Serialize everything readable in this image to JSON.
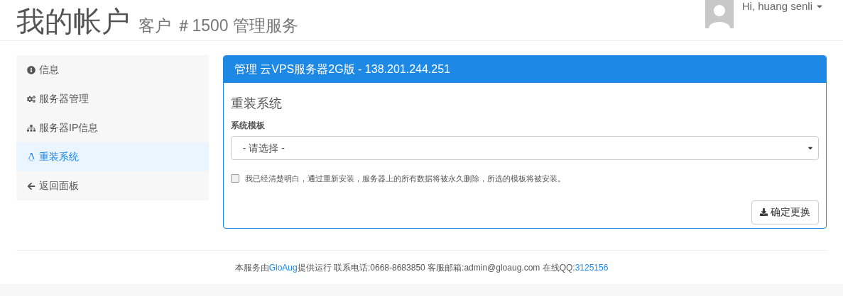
{
  "header": {
    "title": "我的帐户",
    "subtitle": "客户 ＃1500 管理服务"
  },
  "user": {
    "greeting": "Hi, huang senli"
  },
  "sidebar": {
    "items": [
      {
        "label": "信息",
        "selected": false
      },
      {
        "label": "服务器管理",
        "selected": false
      },
      {
        "label": "服务器IP信息",
        "selected": false
      },
      {
        "label": "重装系统",
        "selected": true
      },
      {
        "label": "返回面板",
        "selected": false
      }
    ]
  },
  "panel": {
    "title": "管理 云VPS服务器2G版 - 138.201.244.251",
    "heading": "重装系统",
    "field_label": "系统模板",
    "select_value": "- 请选择 -",
    "confirm": {
      "label": "我已经清楚明白，通过重新安装，服务器上的所有数据将被永久删除，所选的模板将被安装。",
      "checked": false
    },
    "button": "确定更换"
  },
  "footer": {
    "parts": [
      {
        "text": "本服务由",
        "link": false
      },
      {
        "text": "GloAug",
        "link": true
      },
      {
        "text": "提供运行 联系电话:0668-8683850 客服邮箱:admin@gloaug.com 在线QQ:",
        "link": false
      },
      {
        "text": "3125156",
        "link": true
      }
    ]
  }
}
